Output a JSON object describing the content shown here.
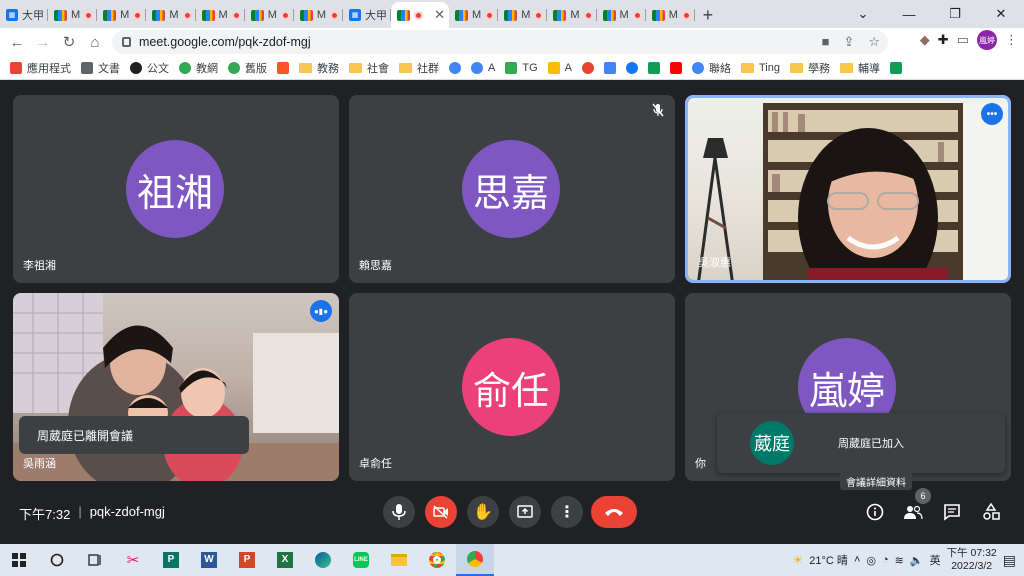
{
  "browser": {
    "tabs": [
      {
        "label": "大甲",
        "type": "cal"
      },
      {
        "label": "M",
        "type": "meet"
      },
      {
        "label": "M",
        "type": "meet"
      },
      {
        "label": "M",
        "type": "meet"
      },
      {
        "label": "M",
        "type": "meet"
      },
      {
        "label": "M",
        "type": "meet"
      },
      {
        "label": "M",
        "type": "meet"
      },
      {
        "label": "大甲",
        "type": "cal"
      },
      {
        "label": "",
        "type": "meet-active"
      },
      {
        "label": "M",
        "type": "meet"
      },
      {
        "label": "M",
        "type": "meet"
      },
      {
        "label": "M",
        "type": "meet"
      },
      {
        "label": "M",
        "type": "meet"
      },
      {
        "label": "M",
        "type": "meet"
      }
    ],
    "url": "meet.google.com/pqk-zdof-mgj",
    "profile_initials": "嵐婷"
  },
  "bookmarks": [
    {
      "label": "應用程式",
      "icon": "apps-grid-icon",
      "color": "#ea4335"
    },
    {
      "label": "文書",
      "icon": "page-icon",
      "color": "#5f6368"
    },
    {
      "label": "公文",
      "icon": "globe-icon",
      "color": "#202124"
    },
    {
      "label": "教網",
      "icon": "chrome-icon",
      "color": "#34a853"
    },
    {
      "label": "舊版",
      "icon": "chrome-icon",
      "color": "#34a853"
    },
    {
      "label": "",
      "icon": "brave-icon",
      "color": "#fb542b"
    },
    {
      "label": "教務",
      "icon": "folder-icon",
      "color": "#f9c74f"
    },
    {
      "label": "社會",
      "icon": "folder-icon",
      "color": "#f9c74f"
    },
    {
      "label": "社群",
      "icon": "folder-icon",
      "color": "#f9c74f"
    },
    {
      "label": "",
      "icon": "google-icon",
      "color": "#4285f4"
    },
    {
      "label": "A",
      "icon": "google-icon",
      "color": "#4285f4"
    },
    {
      "label": "TG",
      "icon": "drive-icon",
      "color": "#34a853"
    },
    {
      "label": "A",
      "icon": "drive-icon",
      "color": "#fbbc04"
    },
    {
      "label": "",
      "icon": "photos-icon",
      "color": "#ea4335"
    },
    {
      "label": "",
      "icon": "calendar-icon",
      "color": "#4285f4"
    },
    {
      "label": "",
      "icon": "facebook-icon",
      "color": "#1877f2"
    },
    {
      "label": "",
      "icon": "pinterest-icon",
      "color": "#0f9d58"
    },
    {
      "label": "",
      "icon": "youtube-icon",
      "color": "#ff0000"
    },
    {
      "label": "聯絡",
      "icon": "google-icon",
      "color": "#4285f4"
    },
    {
      "label": "Ting",
      "icon": "folder-icon",
      "color": "#f9c74f"
    },
    {
      "label": "學務",
      "icon": "folder-icon",
      "color": "#f9c74f"
    },
    {
      "label": "輔導",
      "icon": "folder-icon",
      "color": "#f9c74f"
    },
    {
      "label": "",
      "icon": "sheet-icon",
      "color": "#0f9d58"
    }
  ],
  "meet": {
    "tiles": [
      {
        "id": "t1",
        "name": "李祖湘",
        "avatar_text": "祖湘",
        "avatar_color": "#7e57c2"
      },
      {
        "id": "t2",
        "name": "賴思嘉",
        "avatar_text": "思嘉",
        "avatar_color": "#7e57c2"
      },
      {
        "id": "t3",
        "name": "吳淑惠",
        "video": true
      },
      {
        "id": "t4",
        "name": "吳雨涵",
        "video": true
      },
      {
        "id": "t5",
        "name": "卓俞任",
        "avatar_text": "俞任",
        "avatar_color": "#ec407a"
      },
      {
        "id": "t6",
        "name": "你",
        "avatar_text": "嵐婷",
        "avatar_color": "#7e57c2"
      }
    ],
    "left_toast": "周葳庭已離開會議",
    "join_toast": {
      "avatar_text": "葳庭",
      "avatar_color": "#00796b",
      "message": "周葳庭已加入"
    },
    "tooltip": "會議詳細資料",
    "time": "下午7:32",
    "meeting_code": "pqk-zdof-mgj",
    "people_count": "6"
  },
  "taskbar": {
    "weather": "21°C 晴",
    "ime": "英",
    "time": "下午 07:32",
    "date": "2022/3/2"
  }
}
